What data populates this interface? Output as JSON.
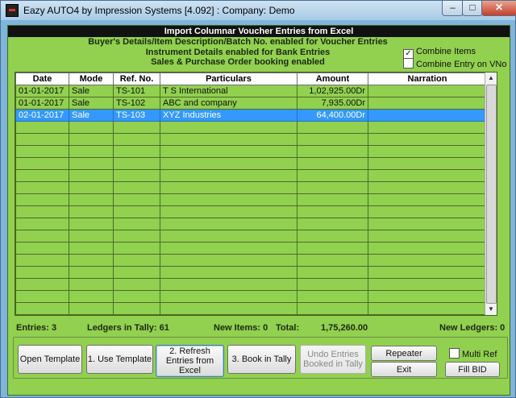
{
  "window": {
    "title": "Eazy AUTO4 by Impression Systems [4.092] : Company: Demo",
    "controls": {
      "minimize": "–",
      "maximize": "□",
      "close": "✕"
    }
  },
  "header": {
    "title": "Import Columnar Voucher Entries from Excel",
    "info_lines": [
      "Buyer's Details/Item Description/Batch No. enabled for Voucher Entries",
      "Instrument Details enabled for Bank Entries",
      "Sales & Purchase Order booking enabled"
    ]
  },
  "options": {
    "combine_items": {
      "label": "Combine Items",
      "checked": true
    },
    "combine_entry_vno": {
      "label": "Combine Entry on VNo",
      "checked": false
    }
  },
  "table": {
    "columns": [
      "Date",
      "Mode",
      "Ref. No.",
      "Particulars",
      "Amount",
      "Narration"
    ],
    "rows": [
      {
        "date": "01-01-2017",
        "mode": "Sale",
        "ref": "TS-101",
        "particulars": "T S International",
        "amount": "1,02,925.00Dr",
        "narration": ""
      },
      {
        "date": "01-01-2017",
        "mode": "Sale",
        "ref": "TS-102",
        "particulars": "ABC and company",
        "amount": "7,935.00Dr",
        "narration": ""
      },
      {
        "date": "02-01-2017",
        "mode": "Sale",
        "ref": "TS-103",
        "particulars": "XYZ Industries",
        "amount": "64,400.00Dr",
        "narration": ""
      }
    ],
    "selected_row": 2
  },
  "footer": {
    "entries": "Entries: 3",
    "ledgers": "Ledgers in Tally: 61",
    "new_items": "New Items: 0",
    "total_label": "Total:",
    "total_value": "1,75,260.00",
    "new_ledgers": "New Ledgers: 0"
  },
  "buttons": {
    "open_template": "Open Template",
    "use_template": "1. Use Template",
    "refresh_entries": "2. Refresh Entries from Excel",
    "book_in_tally": "3. Book in Tally",
    "undo_entries": "Undo Entries Booked in Tally",
    "repeater": "Repeater",
    "exit": "Exit",
    "multi_ref": "Multi Ref",
    "fill_bid": "Fill BID"
  }
}
